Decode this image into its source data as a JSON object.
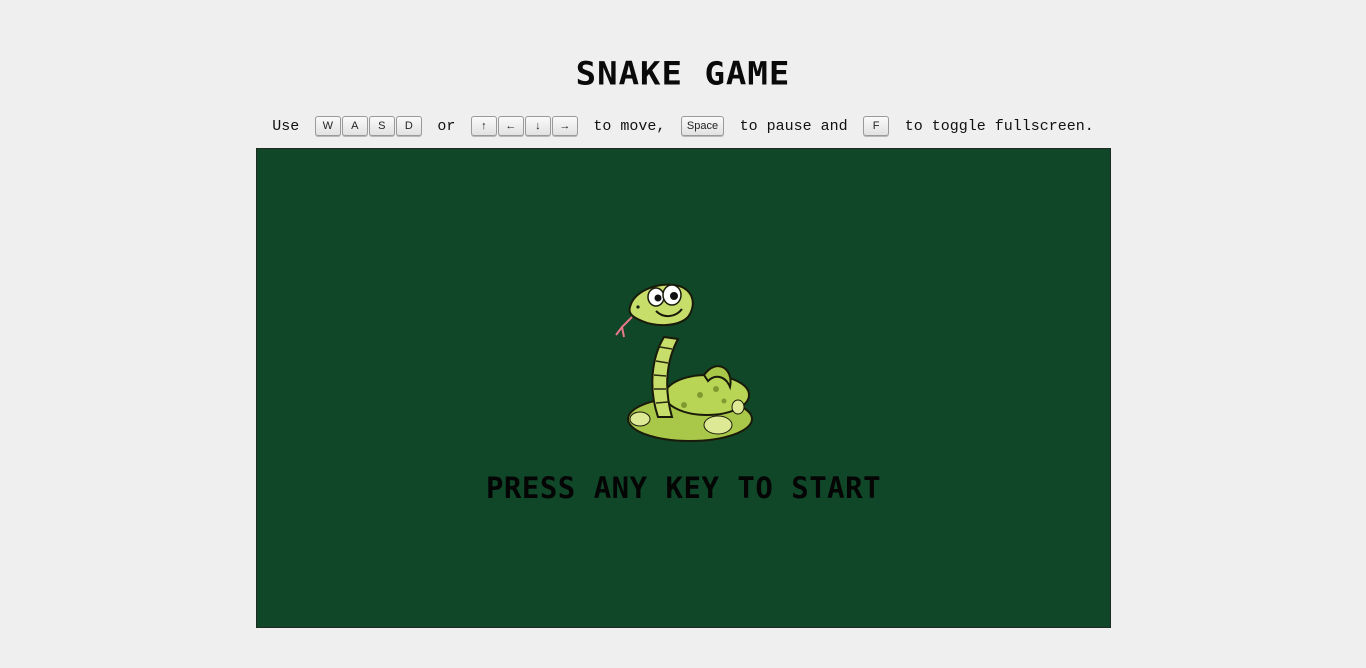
{
  "title": "SNAKE GAME",
  "instructions": {
    "use": "Use",
    "or": "or",
    "to_move": "to move,",
    "to_pause_and": "to pause and",
    "to_toggle": "to toggle fullscreen.",
    "keys": {
      "w": "W",
      "a": "A",
      "s": "S",
      "d": "D",
      "up": "↑",
      "left": "←",
      "down": "↓",
      "right": "→",
      "space": "Space",
      "f": "F"
    }
  },
  "game": {
    "prompt": "PRESS ANY KEY TO START",
    "board_color": "#0f4728",
    "mascot_icon": "snake-mascot-icon"
  }
}
